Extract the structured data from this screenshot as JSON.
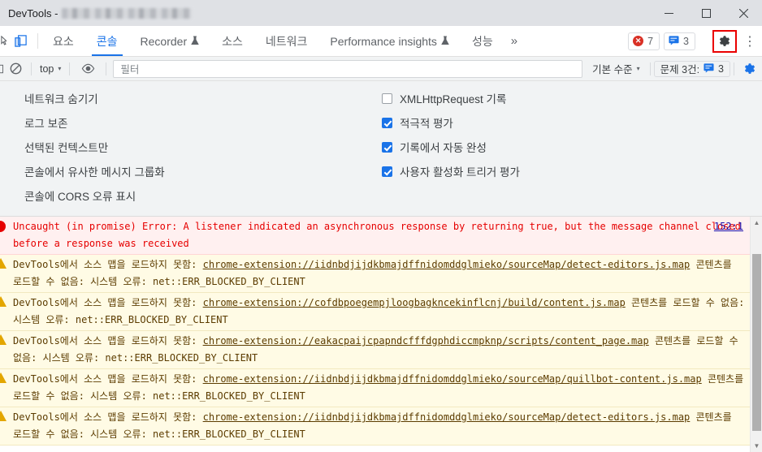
{
  "window": {
    "title_prefix": "DevTools - ",
    "minimize_label": "—",
    "maximize_label": "□",
    "close_label": "✕"
  },
  "tabbar": {
    "tabs": [
      {
        "label": "요소",
        "active": false,
        "flask": false
      },
      {
        "label": "콘솔",
        "active": true,
        "flask": false
      },
      {
        "label": "Recorder",
        "active": false,
        "flask": true
      },
      {
        "label": "소스",
        "active": false,
        "flask": false
      },
      {
        "label": "네트워크",
        "active": false,
        "flask": false
      },
      {
        "label": "Performance insights",
        "active": false,
        "flask": true
      },
      {
        "label": "성능",
        "active": false,
        "flask": false
      }
    ],
    "more_label": "»",
    "error_count": "7",
    "message_count": "3",
    "kebab_label": "⋮",
    "flask_glyph": "🧪",
    "accent_color": "#1a73e8",
    "error_color": "#d93025",
    "highlight_color": "#ea0000"
  },
  "console_toolbar": {
    "context_value": "top",
    "filter_placeholder": "필터",
    "level_value": "기본 수준",
    "issues_label": "문제 3건:",
    "issues_count": "3",
    "caret_glyph": "▾"
  },
  "settings": {
    "left": [
      {
        "label": "네트워크 숨기기",
        "checked": false
      },
      {
        "label": "로그 보존",
        "checked": false
      },
      {
        "label": "선택된 컨텍스트만",
        "checked": false
      },
      {
        "label": "콘솔에서 유사한 메시지 그룹화",
        "checked": true
      },
      {
        "label": "콘솔에 CORS 오류 표시",
        "checked": true
      }
    ],
    "right": [
      {
        "label": "XMLHttpRequest 기록",
        "checked": false
      },
      {
        "label": "적극적 평가",
        "checked": true
      },
      {
        "label": "기록에서 자동 완성",
        "checked": true
      },
      {
        "label": "사용자 활성화 트리거 평가",
        "checked": true
      }
    ]
  },
  "console_messages": [
    {
      "type": "error",
      "text": "Uncaught (in promise) Error: A listener indicated an asynchronous response by returning true, but the message channel closed before a response was received",
      "source": "152:1"
    },
    {
      "type": "warn",
      "prefix": "DevTools에서 소스 맵을 로드하지 못함: ",
      "link": "chrome-extension://iidnbdjijdkbmajdffnidomddglmieko/sourceMap/detect-editors.js.map",
      "suffix": " 콘텐츠를 로드할 수 없음: 시스템 오류: net::ERR_BLOCKED_BY_CLIENT"
    },
    {
      "type": "warn",
      "prefix": "DevTools에서 소스 맵을 로드하지 못함: ",
      "link": "chrome-extension://cofdbpoegempjloogbagkncekinflcnj/build/content.js.map",
      "suffix": " 콘텐츠를 로드할 수 없음: 시스템 오류: net::ERR_BLOCKED_BY_CLIENT"
    },
    {
      "type": "warn",
      "prefix": "DevTools에서 소스 맵을 로드하지 못함: ",
      "link": "chrome-extension://eakacpaijcpapndcfffdgphdiccmpknp/scripts/content_page.map",
      "suffix": " 콘텐츠를 로드할 수 없음: 시스템 오류: net::ERR_BLOCKED_BY_CLIENT"
    },
    {
      "type": "warn",
      "prefix": "DevTools에서 소스 맵을 로드하지 못함: ",
      "link": "chrome-extension://iidnbdjijdkbmajdffnidomddglmieko/sourceMap/quillbot-content.js.map",
      "suffix": " 콘텐츠를 로드할 수 없음: 시스템 오류: net::ERR_BLOCKED_BY_CLIENT"
    },
    {
      "type": "warn",
      "prefix": "DevTools에서 소스 맵을 로드하지 못함: ",
      "link": "chrome-extension://iidnbdjijdkbmajdffnidomddglmieko/sourceMap/detect-editors.js.map",
      "suffix": " 콘텐츠를 로드할 수 없음: 시스템 오류: net::ERR_BLOCKED_BY_CLIENT"
    }
  ]
}
